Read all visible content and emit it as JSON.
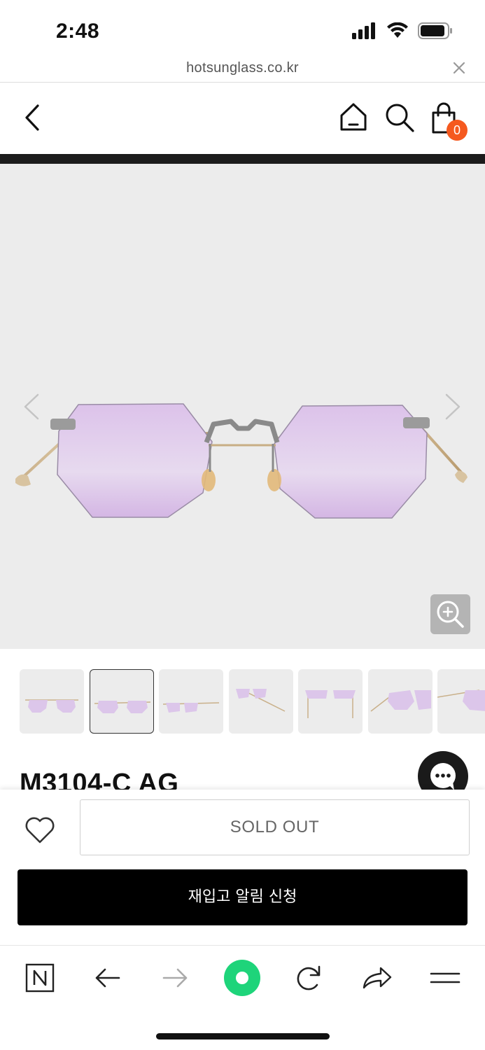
{
  "status_bar": {
    "time": "2:48",
    "icons": [
      "signal-icon",
      "wifi-icon",
      "battery-icon"
    ]
  },
  "url_bar": {
    "url": "hotsunglass.co.kr",
    "close_icon": "close-icon"
  },
  "header": {
    "icons": [
      "back-icon",
      "home-icon",
      "search-icon",
      "cart-icon"
    ],
    "cart_count": "0"
  },
  "product": {
    "title": "M3104-C AG",
    "thumbnail_count": 7,
    "active_thumbnail": 2
  },
  "purchase": {
    "sold_out_label": "SOLD OUT",
    "restock_label": "재입고 알림 신청"
  },
  "toolbar": {
    "icons": [
      "naver-icon",
      "back-arrow-icon",
      "forward-arrow-icon",
      "green-dot-icon",
      "refresh-icon",
      "share-icon",
      "menu-icon"
    ]
  },
  "colors": {
    "accent": "#f5591f",
    "header_bar": "#1c1c1c",
    "lens": "#d9bde6",
    "green": "#1ed47a"
  }
}
